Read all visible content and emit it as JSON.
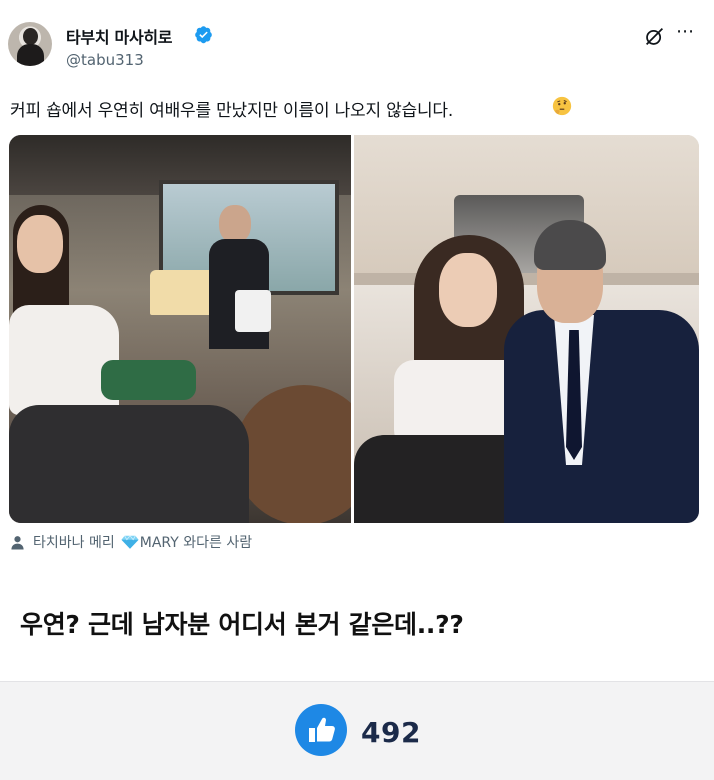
{
  "tweet": {
    "author": {
      "name": "타부치 마사히로",
      "handle": "@tabu313",
      "verified": true
    },
    "text": "커피 숍에서 우연히 여배우를 만났지만 이름이 나오지 않습니다.",
    "emoji": "thinking-face-icon",
    "media": {
      "photos": [
        "photo-cafe-woman-sitting",
        "photo-woman-and-man-posing"
      ],
      "caption_person": "타치바나 메리",
      "caption_tag": "MARY 와다른 사람"
    },
    "accent_color": "#1d9bf0"
  },
  "comment": {
    "text": "우연? 근데 남자분 어디서 본거 같은데..??"
  },
  "likes": {
    "count": "492",
    "icon": "thumbs-up-icon",
    "color": "#1e88e5"
  }
}
